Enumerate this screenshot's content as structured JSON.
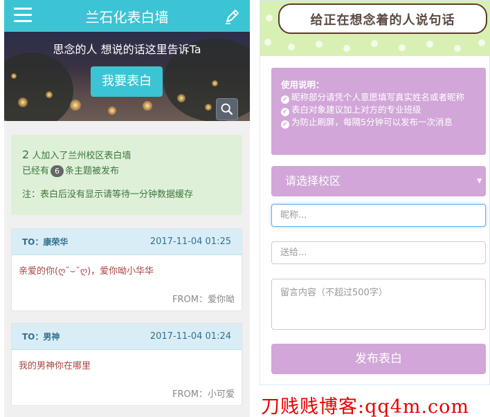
{
  "header": {
    "title": "兰石化表白墙",
    "menu_icon": "hamburger-icon",
    "edit_icon": "pen-icon",
    "bar_color": "#3cc4d4"
  },
  "hero": {
    "text": "思念的人 想说的话这里告诉Ta",
    "confess_button": "我要表白",
    "search_icon": "search-icon"
  },
  "info": {
    "joined_count": "2",
    "joined_text": "人加入了兰州校区表白墙",
    "published_prefix": "已经有",
    "published_count": "6",
    "published_suffix": "条主题被发布",
    "note": "注：表白后没有显示请等待一分钟数据缓存"
  },
  "messages": [
    {
      "to": "TO：康荣华",
      "time": "2017-11-04 01:25",
      "body": "亲爱的你(ღ˘⌣˘ღ)，爱你呦小华华",
      "from": "FROM：爱你呦"
    },
    {
      "to": "TO：男神",
      "time": "2017-11-04 01:24",
      "body": "我的男神你在哪里",
      "from": "FROM：小可爱"
    }
  ],
  "form": {
    "banner_text": "给正在想念着的人说句话",
    "usage_title": "使用说明：",
    "usage_items": [
      "昵称部分请凭个人意愿填写真实姓名或者昵称",
      "表白对象建议加上对方的专业班级",
      "为防止刷屏，每隔5分钟可以发布一次消息"
    ],
    "campus_select": "请选择校区",
    "nickname_placeholder": "昵称...",
    "recipient_placeholder": "送给...",
    "content_placeholder": "留言内容（不超过500字）",
    "publish_button": "发布表白",
    "accent_color": "#d2a6d8"
  },
  "watermark": "刀贱贱博客:qq4m.com"
}
